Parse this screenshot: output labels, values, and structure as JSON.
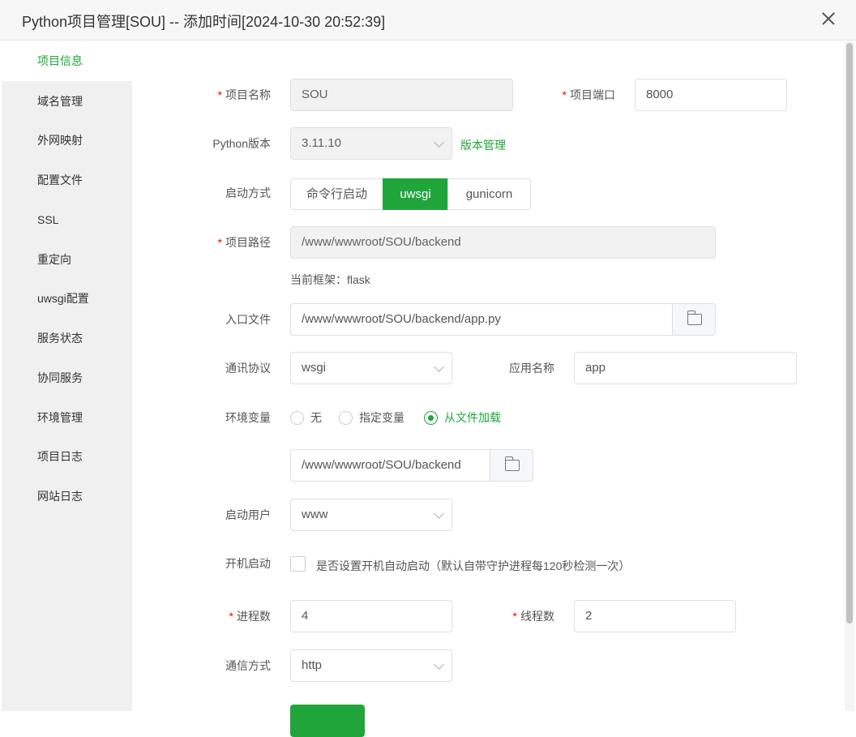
{
  "window": {
    "title": "Python项目管理[SOU] -- 添加时间[2024-10-30 20:52:39]"
  },
  "sidebar": {
    "items": [
      {
        "label": "项目信息",
        "active": true
      },
      {
        "label": "域名管理"
      },
      {
        "label": "外网映射"
      },
      {
        "label": "配置文件"
      },
      {
        "label": "SSL"
      },
      {
        "label": "重定向"
      },
      {
        "label": "uwsgi配置"
      },
      {
        "label": "服务状态"
      },
      {
        "label": "协同服务"
      },
      {
        "label": "环境管理"
      },
      {
        "label": "项目日志"
      },
      {
        "label": "网站日志"
      }
    ]
  },
  "form": {
    "project_name": {
      "label": "项目名称",
      "value": "SOU"
    },
    "project_port": {
      "label": "项目端口",
      "value": "8000"
    },
    "python_version": {
      "label": "Python版本",
      "value": "3.11.10",
      "manage_link": "版本管理"
    },
    "start_mode": {
      "label": "启动方式",
      "options": [
        "命令行启动",
        "uwsgi",
        "gunicorn"
      ],
      "selected": "uwsgi"
    },
    "project_path": {
      "label": "项目路径",
      "value": "/www/wwwroot/SOU/backend"
    },
    "framework_hint": "当前框架：flask",
    "entry_file": {
      "label": "入口文件",
      "value": "/www/wwwroot/SOU/backend/app.py"
    },
    "protocol": {
      "label": "通讯协议",
      "value": "wsgi"
    },
    "app_name": {
      "label": "应用名称",
      "value": "app"
    },
    "env_vars": {
      "label": "环境变量",
      "options": [
        "无",
        "指定变量",
        "从文件加载"
      ],
      "selected": "从文件加载"
    },
    "env_file": {
      "value": "/www/wwwroot/SOU/backend"
    },
    "run_user": {
      "label": "启动用户",
      "value": "www"
    },
    "autostart": {
      "label": "开机启动",
      "text": "是否设置开机自动启动（默认自带守护进程每120秒检测一次）",
      "checked": false
    },
    "processes": {
      "label": "进程数",
      "value": "4"
    },
    "threads": {
      "label": "线程数",
      "value": "2"
    },
    "comm_mode": {
      "label": "通信方式",
      "value": "http"
    }
  },
  "colors": {
    "accent": "#20a53a",
    "required": "#ef0808"
  }
}
